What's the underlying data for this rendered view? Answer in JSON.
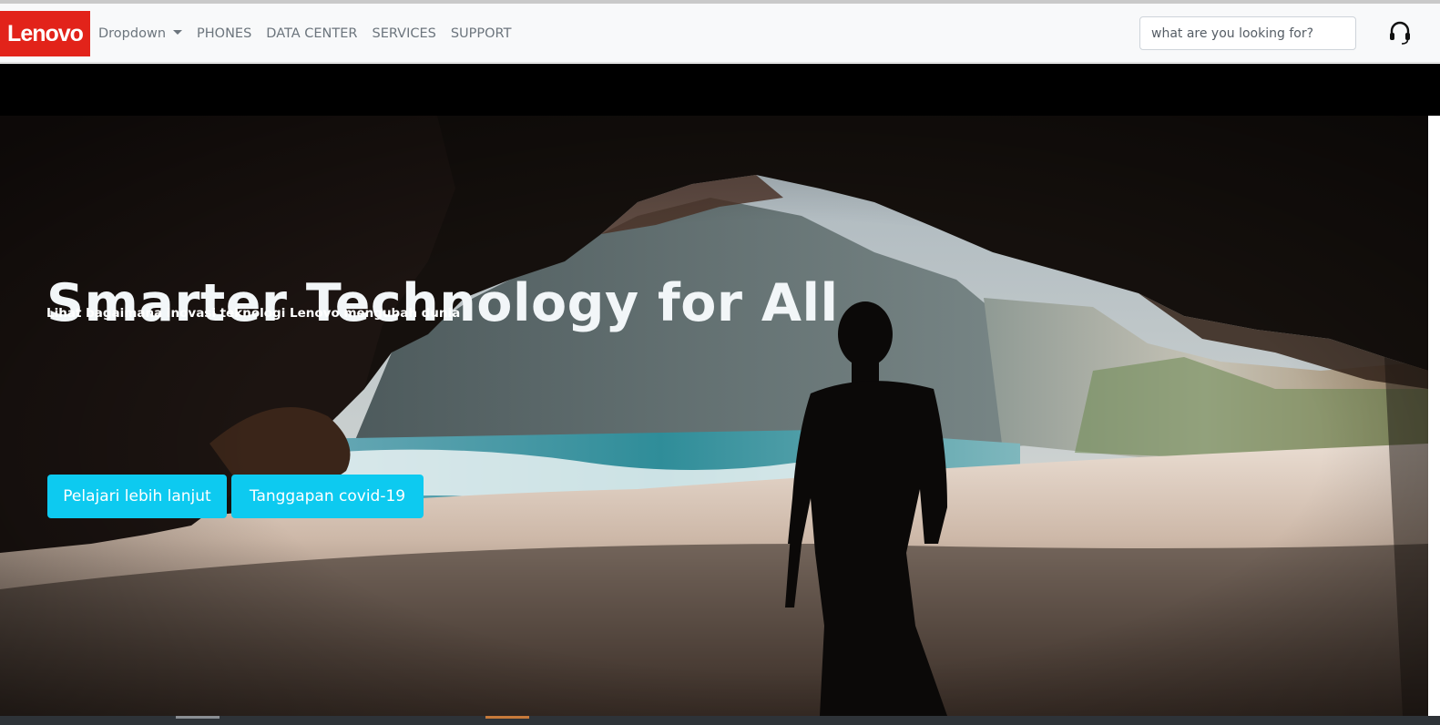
{
  "navbar": {
    "logo_text": "Lenovo",
    "links": [
      "Dropdown",
      "PHONES",
      "DATA CENTER",
      "SERVICES",
      "SUPPORT"
    ],
    "search_placeholder": "what are you looking for?",
    "support_icon": "headset-icon"
  },
  "hero": {
    "title": "Smarter Technology for All",
    "subtitle": "Lihat bagaimana inovasi teknologi Lenovo mengubah dunia",
    "buttons": {
      "learn_more": "Pelajari lebih lanjut",
      "covid": "Tanggapan covid-19"
    }
  },
  "colors": {
    "brand": "#e2231a",
    "button": "#0dcaf0",
    "navbar_bg": "#f8f9fa"
  }
}
